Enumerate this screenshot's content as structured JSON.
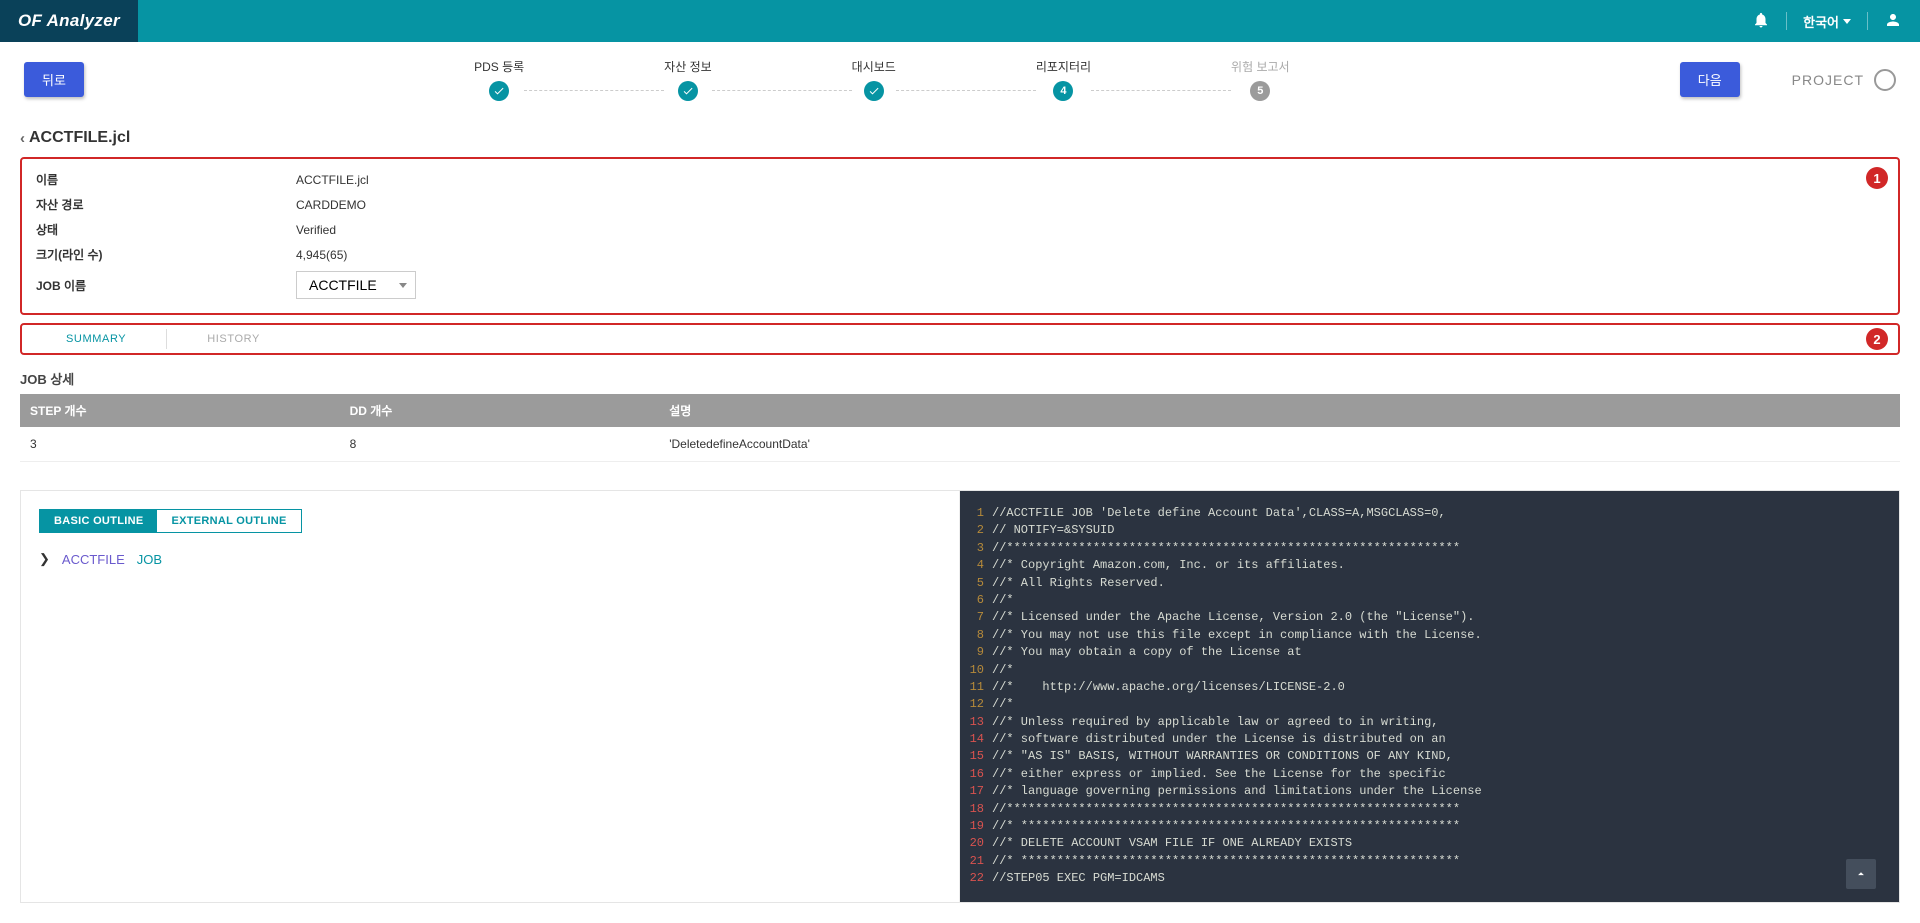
{
  "header": {
    "logo": "OF Analyzer",
    "language": "한국어"
  },
  "topbar": {
    "back": "뒤로",
    "next": "다음",
    "project": "PROJECT",
    "steps": [
      {
        "label": "PDS 등록",
        "state": "check"
      },
      {
        "label": "자산 정보",
        "state": "check"
      },
      {
        "label": "대시보드",
        "state": "check"
      },
      {
        "label": "리포지터리",
        "state": "num",
        "num": "4"
      },
      {
        "label": "위험 보고서",
        "state": "gray",
        "num": "5"
      }
    ]
  },
  "breadcrumb": "ACCTFILE.jcl",
  "annotations": {
    "a1": "1",
    "a2": "2"
  },
  "info": {
    "name_label": "이름",
    "name_val": "ACCTFILE.jcl",
    "path_label": "자산 경로",
    "path_val": "CARDDEMO",
    "status_label": "상태",
    "status_val": "Verified",
    "size_label": "크기(라인 수)",
    "size_val": "4,945(65)",
    "job_label": "JOB 이름",
    "job_val": "ACCTFILE"
  },
  "tabs": {
    "summary": "SUMMARY",
    "history": "HISTORY"
  },
  "job_detail": {
    "title": "JOB 상세",
    "headers": {
      "step": "STEP 개수",
      "dd": "DD 개수",
      "desc": "설명"
    },
    "row": {
      "step": "3",
      "dd": "8",
      "desc": "'DeletedefineAccountData'"
    }
  },
  "outline": {
    "basic": "BASIC OUTLINE",
    "external": "EXTERNAL OUTLINE",
    "node1": "ACCTFILE",
    "node2": "JOB"
  },
  "code": [
    {
      "n": "1",
      "t": "//ACCTFILE JOB 'Delete define Account Data',CLASS=A,MSGCLASS=0,"
    },
    {
      "n": "2",
      "t": "// NOTIFY=&SYSUID"
    },
    {
      "n": "3",
      "t": "//***************************************************************"
    },
    {
      "n": "4",
      "t": "//* Copyright Amazon.com, Inc. or its affiliates."
    },
    {
      "n": "5",
      "t": "//* All Rights Reserved."
    },
    {
      "n": "6",
      "t": "//*"
    },
    {
      "n": "7",
      "t": "//* Licensed under the Apache License, Version 2.0 (the \"License\")."
    },
    {
      "n": "8",
      "t": "//* You may not use this file except in compliance with the License."
    },
    {
      "n": "9",
      "t": "//* You may obtain a copy of the License at"
    },
    {
      "n": "10",
      "t": "//*"
    },
    {
      "n": "11",
      "t": "//*    http://www.apache.org/licenses/LICENSE-2.0"
    },
    {
      "n": "12",
      "t": "//*"
    },
    {
      "n": "13",
      "t": "//* Unless required by applicable law or agreed to in writing,",
      "hl": true
    },
    {
      "n": "14",
      "t": "//* software distributed under the License is distributed on an",
      "hl": true
    },
    {
      "n": "15",
      "t": "//* \"AS IS\" BASIS, WITHOUT WARRANTIES OR CONDITIONS OF ANY KIND,",
      "hl": true
    },
    {
      "n": "16",
      "t": "//* either express or implied. See the License for the specific",
      "hl": true
    },
    {
      "n": "17",
      "t": "//* language governing permissions and limitations under the License",
      "hl": true
    },
    {
      "n": "18",
      "t": "//***************************************************************",
      "hl": true
    },
    {
      "n": "19",
      "t": "//* *************************************************************",
      "hl": true
    },
    {
      "n": "20",
      "t": "//* DELETE ACCOUNT VSAM FILE IF ONE ALREADY EXISTS",
      "hl": true
    },
    {
      "n": "21",
      "t": "//* *************************************************************",
      "hl": true
    },
    {
      "n": "22",
      "t": "//STEP05 EXEC PGM=IDCAMS",
      "hl": true
    }
  ]
}
